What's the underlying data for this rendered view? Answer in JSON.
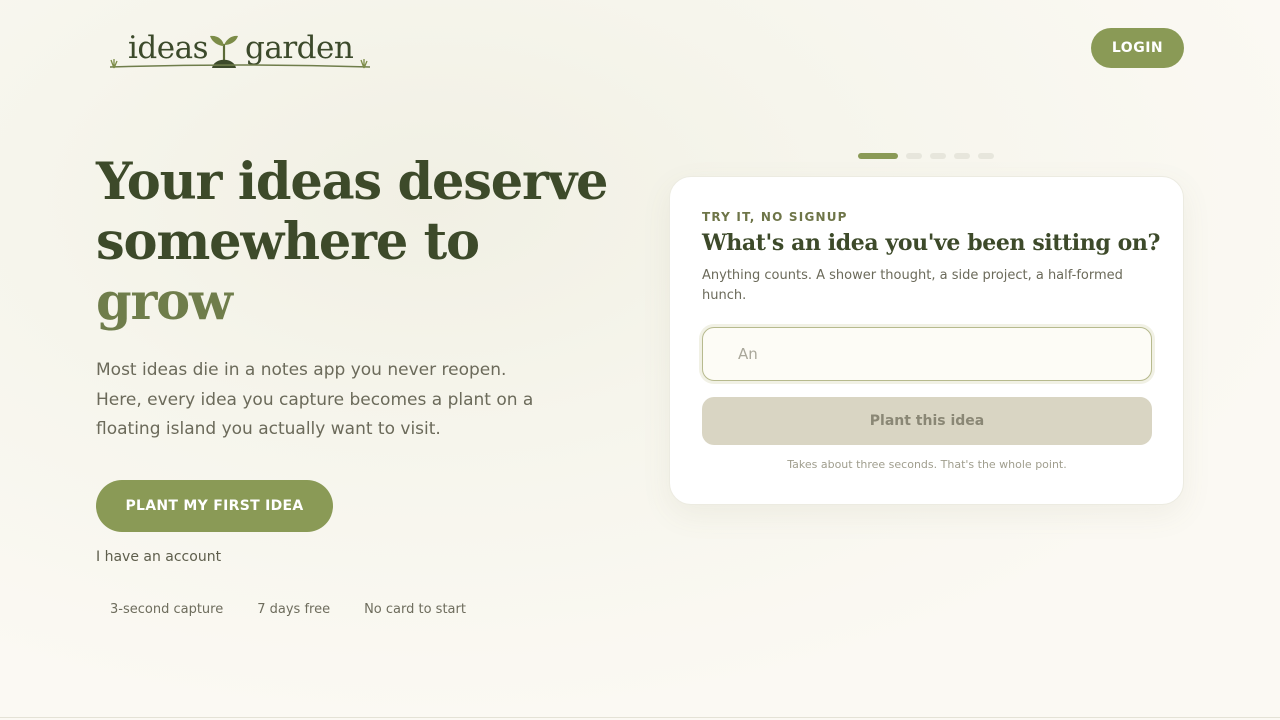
{
  "brand": {
    "name_part1": "ideas",
    "name_part2": "garden",
    "logo_icon": "sprout-icon"
  },
  "header": {
    "login_label": "LOGIN"
  },
  "hero": {
    "headline_line1": "Your ideas deserve",
    "headline_line2": "somewhere to",
    "headline_accent": "grow",
    "subtext": "Most ideas die in a notes app you never reopen. Here, every idea you capture becomes a plant on a floating island you actually want to visit.",
    "cta_label": "PLANT MY FIRST IDEA",
    "account_link": "I have an account",
    "features": [
      "3-second capture",
      "7 days free",
      "No card to start"
    ]
  },
  "carousel": {
    "total": 5,
    "active": 1
  },
  "try_card": {
    "eyebrow": "TRY IT, NO SIGNUP",
    "title": "What's an idea you've been sitting on?",
    "description": "Anything counts. A shower thought, a side project, a half-formed hunch.",
    "input_placeholder": "An",
    "button_label": "Plant this idea",
    "note": "Takes about three seconds. That's the whole point."
  },
  "colors": {
    "primary": "#8a9a56",
    "headline": "#3d4a2a",
    "accent_text": "#6f7d4b",
    "background": "#fbf9f3",
    "button_disabled": "#d9d5c3"
  }
}
